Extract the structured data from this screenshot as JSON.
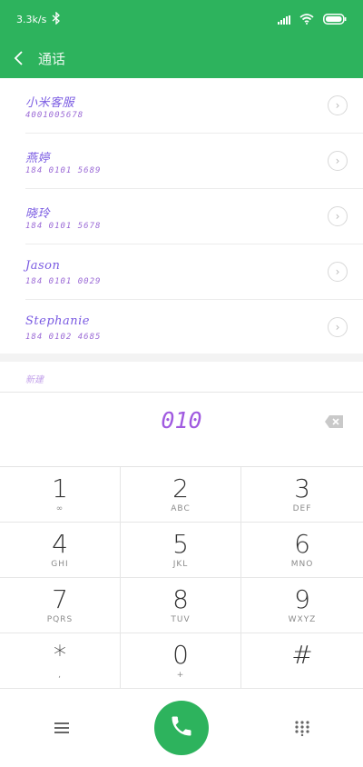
{
  "status": {
    "network_speed": "3.3k/s"
  },
  "header": {
    "title": "通话"
  },
  "contacts": [
    {
      "name": "小米客服",
      "number": "4001005678"
    },
    {
      "name": "燕婷",
      "number": "184 0101 5689"
    },
    {
      "name": "晓玲",
      "number": "184 0101 5678"
    },
    {
      "name": "Jason",
      "number": "184 0101 0029"
    },
    {
      "name": "Stephanie",
      "number": "184 0102 4685"
    }
  ],
  "new_contact_label": "新建",
  "dialed_number": "010",
  "keypad": [
    {
      "digit": "1",
      "letters": "∞"
    },
    {
      "digit": "2",
      "letters": "ABC"
    },
    {
      "digit": "3",
      "letters": "DEF"
    },
    {
      "digit": "4",
      "letters": "GHI"
    },
    {
      "digit": "5",
      "letters": "JKL"
    },
    {
      "digit": "6",
      "letters": "MNO"
    },
    {
      "digit": "7",
      "letters": "PQRS"
    },
    {
      "digit": "8",
      "letters": "TUV"
    },
    {
      "digit": "9",
      "letters": "WXYZ"
    },
    {
      "digit": "*",
      "letters": ","
    },
    {
      "digit": "0",
      "letters": "+"
    },
    {
      "digit": "#",
      "letters": ""
    }
  ],
  "colors": {
    "primary": "#2db35d"
  },
  "icons": {
    "back": "back-icon",
    "info": "chevron-right-circle-icon",
    "backspace": "backspace-icon",
    "menu": "menu-icon",
    "call": "phone-icon",
    "dialpad": "dialpad-icon"
  }
}
